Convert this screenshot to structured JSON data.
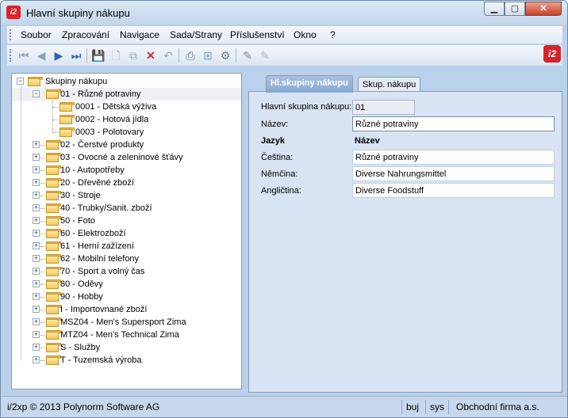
{
  "window": {
    "title": "Hlavní skupiny nákupu",
    "icon": "i2-app-icon"
  },
  "menu": [
    "Soubor",
    "Zpracování",
    "Navigace",
    "Sada/Strany",
    "Příslušenství",
    "Okno",
    "?"
  ],
  "toolbar_icons": [
    "first-record-icon",
    "prev-record-icon",
    "next-record-icon",
    "last-record-icon",
    "save-icon",
    "new-icon",
    "copy-icon",
    "delete-icon",
    "undo-icon",
    "print-icon",
    "tree-icon",
    "settings-icon",
    "edit-icon",
    "edit-disabled-icon"
  ],
  "tree": {
    "root": "Skupiny nákupu",
    "items": [
      {
        "label": "01  -  Různé potraviny",
        "expanded": true,
        "selected": true,
        "children": [
          {
            "label": "0001  -  Dětská výživa"
          },
          {
            "label": "0002  -  Hotová jídla"
          },
          {
            "label": "0003  -  Polotovary"
          }
        ]
      },
      {
        "label": "02  -  Čerstvé produkty"
      },
      {
        "label": "03  -  Ovocné a zeleninové šťávy"
      },
      {
        "label": "10  -  Autopotřeby"
      },
      {
        "label": "20  -  Dřevěné zboží"
      },
      {
        "label": "30  -  Stroje"
      },
      {
        "label": "40  -  Trubky/Sanit. zboží"
      },
      {
        "label": "50  -  Foto"
      },
      {
        "label": "60  -  Elektrozboží"
      },
      {
        "label": "61  -  Herní zažízení"
      },
      {
        "label": "62  -  Mobilní telefony"
      },
      {
        "label": "70  -  Sport a volný čas"
      },
      {
        "label": "80  -  Oděvy"
      },
      {
        "label": "90  -  Hobby"
      },
      {
        "label": "I  -  Importovnané zboží"
      },
      {
        "label": "MSZ04  -  Men's Supersport Zima"
      },
      {
        "label": "MTZ04  -  Men's Technical Zima"
      },
      {
        "label": "S  -  Služby"
      },
      {
        "label": "T  -  Tuzemská výroba"
      }
    ]
  },
  "tabs": [
    "Hl.skupiny nákupu",
    "Skup. nákupu"
  ],
  "form": {
    "code_label": "Hlavní skupina nákupu:",
    "code_value": "01",
    "name_label": "Název:",
    "name_value": "Různé potraviny",
    "col_lang": "Jazyk",
    "col_name": "Název",
    "translations": [
      {
        "lang": "Čeština:",
        "value": "Různé potraviny"
      },
      {
        "lang": "Němčina:",
        "value": "Diverse Nahrungsmittel"
      },
      {
        "lang": "Angličtina:",
        "value": "Diverse Foodstuff"
      }
    ]
  },
  "status": {
    "copyright": "i/2xp © 2013 Polynorm Software AG",
    "mode": "buj",
    "user": "sys",
    "company": "Obchodní firma a.s."
  }
}
